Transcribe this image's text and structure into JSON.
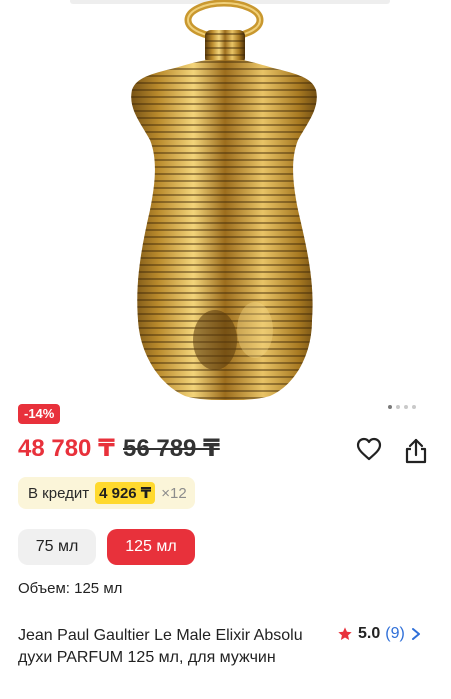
{
  "product": {
    "discount_badge": "-14%",
    "price": "48 780 ₸",
    "old_price": "56 789 ₸",
    "credit_label": "В кредит",
    "credit_amount": "4 926 ₸",
    "credit_months": "×12",
    "volume_options": [
      "75 мл",
      "125 мл"
    ],
    "selected_volume_index": 1,
    "volume_label": "Объем: 125 мл",
    "title": "Jean Paul Gaultier Le Male Elixir Absolu духи PARFUM 125 мл, для мужчин",
    "rating": "5.0",
    "review_count": "(9)"
  },
  "gallery": {
    "image_count": 4,
    "active_index": 0
  },
  "icons": {
    "favorite": "heart-icon",
    "share": "share-icon",
    "rating": "star-icon",
    "chevron": "chevron-right-icon"
  },
  "colors": {
    "accent": "#e8313b",
    "credit_bg": "#fbf5d9",
    "credit_highlight": "#ffd92e",
    "link": "#2f6fd8"
  }
}
